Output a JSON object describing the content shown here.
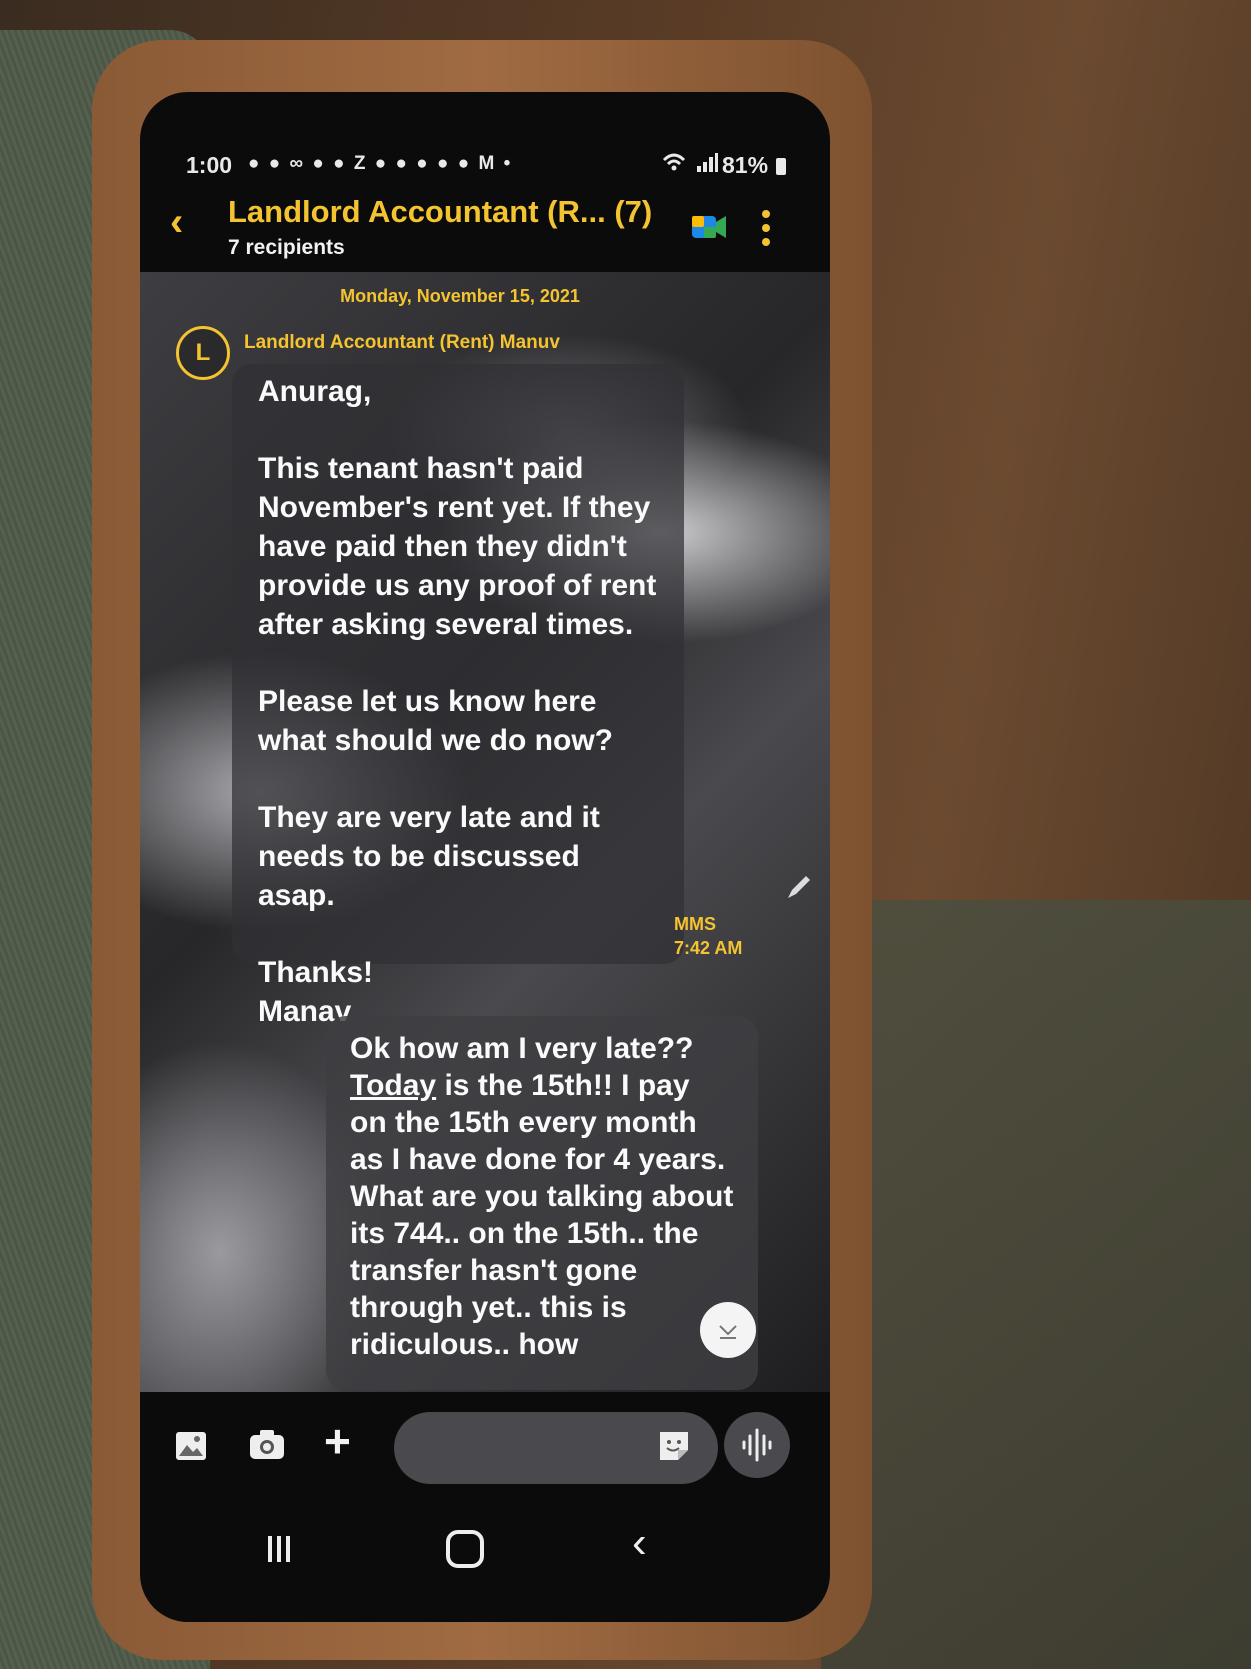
{
  "status_bar": {
    "time": "1:00",
    "notification_icons": "● ● ∞ ● ● Z ● ● ● ● ● M •",
    "battery": "81%"
  },
  "header": {
    "back_glyph": "‹",
    "title": "Landlord Accountant (R... (7)",
    "subtitle": "7 recipients"
  },
  "conversation": {
    "date": "Monday, November 15, 2021",
    "incoming": {
      "avatar_letter": "L",
      "sender": "Landlord Accountant (Rent) Manuv",
      "greeting": "Anurag,",
      "para1": "This tenant hasn't paid November's rent yet. If they have paid then they didn't provide us any proof of rent after asking several times.",
      "para2": "Please let us know here what should we do now?",
      "para3": "They are very late and it needs to be discussed asap.",
      "signoff": "Thanks!",
      "signature": "Manav",
      "type": "MMS",
      "time": "7:42 AM"
    },
    "outgoing": {
      "line1": "Ok how am I very late??",
      "today": "Today",
      "text": "is the 15th!! I pay on the 15th every month as I have done for 4 years. What are you talking about its 744.. on the 15th.. the transfer hasn't gone through yet.. this is ridiculous.. how"
    }
  },
  "composer": {
    "plus_glyph": "+"
  },
  "colors": {
    "accent": "#f4c430",
    "bubble_in": "#303034",
    "bubble_out": "#3e3e42"
  },
  "icons": [
    "gallery-icon",
    "camera-icon",
    "sticker-icon",
    "voice-icon",
    "meet-icon",
    "more-icon",
    "pencil-icon",
    "scroll-down-icon"
  ]
}
